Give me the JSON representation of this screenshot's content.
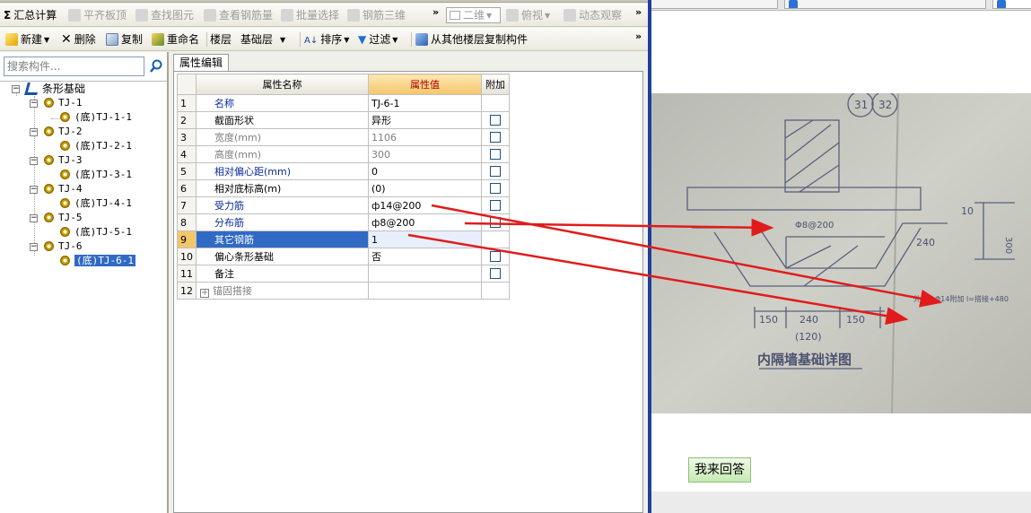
{
  "toolbar1": {
    "sum_label": "汇总计算",
    "items": [
      "平齐板顶",
      "查找图元",
      "查看钢筋量",
      "批量选择",
      "钢筋三维"
    ],
    "view_mode": "二维",
    "view_label": "俯视",
    "dynamic_label": "动态观察",
    "more": "»"
  },
  "toolbar2": {
    "new_label": "新建",
    "delete_label": "删除",
    "copy_label": "复制",
    "rename_label": "重命名",
    "floor_label": "楼层",
    "floor_value": "基础层",
    "sort_label": "排序",
    "filter_label": "过滤",
    "copy_from_label": "从其他楼层复制构件",
    "more": "»"
  },
  "sidebar": {
    "search_placeholder": "搜索构件...",
    "root": "条形基础",
    "groups": [
      {
        "label": "TJ-1",
        "child": "(底)TJ-1-1"
      },
      {
        "label": "TJ-2",
        "child": "(底)TJ-2-1"
      },
      {
        "label": "TJ-3",
        "child": "(底)TJ-3-1"
      },
      {
        "label": "TJ-4",
        "child": "(底)TJ-4-1"
      },
      {
        "label": "TJ-5",
        "child": "(底)TJ-5-1"
      },
      {
        "label": "TJ-6",
        "child": "(底)TJ-6-1"
      }
    ]
  },
  "props": {
    "tab": "属性编辑",
    "headers": {
      "name": "属性名称",
      "value": "属性值",
      "extra": "附加"
    },
    "rows": [
      {
        "num": "1",
        "name": "名称",
        "value": "TJ-6-1",
        "check": false,
        "style": "blue"
      },
      {
        "num": "2",
        "name": "截面形状",
        "value": "异形",
        "check": true,
        "style": "black"
      },
      {
        "num": "3",
        "name": "宽度(mm)",
        "value": "1106",
        "check": true,
        "style": "gray"
      },
      {
        "num": "4",
        "name": "高度(mm)",
        "value": "300",
        "check": true,
        "style": "gray"
      },
      {
        "num": "5",
        "name": "相对偏心距(mm)",
        "value": "0",
        "check": true,
        "style": "blue"
      },
      {
        "num": "6",
        "name": "相对底标高(m)",
        "value": "(0)",
        "check": true,
        "style": "black"
      },
      {
        "num": "7",
        "name": "受力筋",
        "value": "ф14@200",
        "check": true,
        "style": "blue"
      },
      {
        "num": "8",
        "name": "分布筋",
        "value": "ф8@200",
        "check": true,
        "style": "blue"
      },
      {
        "num": "9",
        "name": "其它钢筋",
        "value": "1",
        "check": false,
        "style": "selected"
      },
      {
        "num": "10",
        "name": "偏心条形基础",
        "value": "否",
        "check": true,
        "style": "black"
      },
      {
        "num": "11",
        "name": "备注",
        "value": "",
        "check": true,
        "style": "black"
      },
      {
        "num": "12",
        "name": "锚固搭接",
        "value": "",
        "check": false,
        "style": "gray",
        "expand": "+"
      }
    ]
  },
  "web": {
    "answer_button": "我来回答",
    "drawing": {
      "grid_labels": [
        "31",
        "32"
      ],
      "rebar_label": "Φ8@200",
      "dims": [
        "150",
        "240",
        "150",
        "(120)",
        "300",
        "10",
        "240"
      ],
      "note": "外侧：Φ14附加 l=搭接+480",
      "caption": "内隔墙基础详图"
    }
  },
  "colors": {
    "arrow": "#e11b1b",
    "selection": "#316ac5",
    "divider": "#1f3f9c",
    "header_value": "#f5c66a"
  }
}
